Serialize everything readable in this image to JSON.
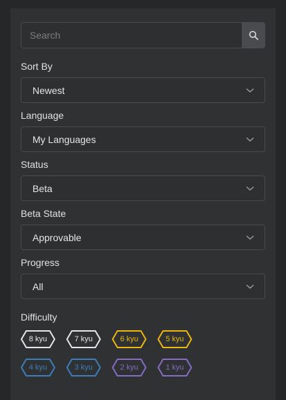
{
  "search": {
    "placeholder": "Search",
    "value": ""
  },
  "filters": [
    {
      "label": "Sort By",
      "value": "Newest"
    },
    {
      "label": "Language",
      "value": "My Languages"
    },
    {
      "label": "Status",
      "value": "Beta"
    },
    {
      "label": "Beta State",
      "value": "Approvable"
    },
    {
      "label": "Progress",
      "value": "All"
    }
  ],
  "difficulty": {
    "label": "Difficulty",
    "badges": [
      {
        "label": "8 kyu",
        "color": "#e6e6e6"
      },
      {
        "label": "7 kyu",
        "color": "#e6e6e6"
      },
      {
        "label": "6 kyu",
        "color": "#ecb613"
      },
      {
        "label": "5 kyu",
        "color": "#ecb613"
      },
      {
        "label": "4 kyu",
        "color": "#3c7ebb"
      },
      {
        "label": "3 kyu",
        "color": "#3c7ebb"
      },
      {
        "label": "2 kyu",
        "color": "#866cc7"
      },
      {
        "label": "1 kyu",
        "color": "#866cc7"
      }
    ]
  },
  "icons": {
    "search": "search-icon",
    "select_arrow": "chevron-down-icon"
  }
}
